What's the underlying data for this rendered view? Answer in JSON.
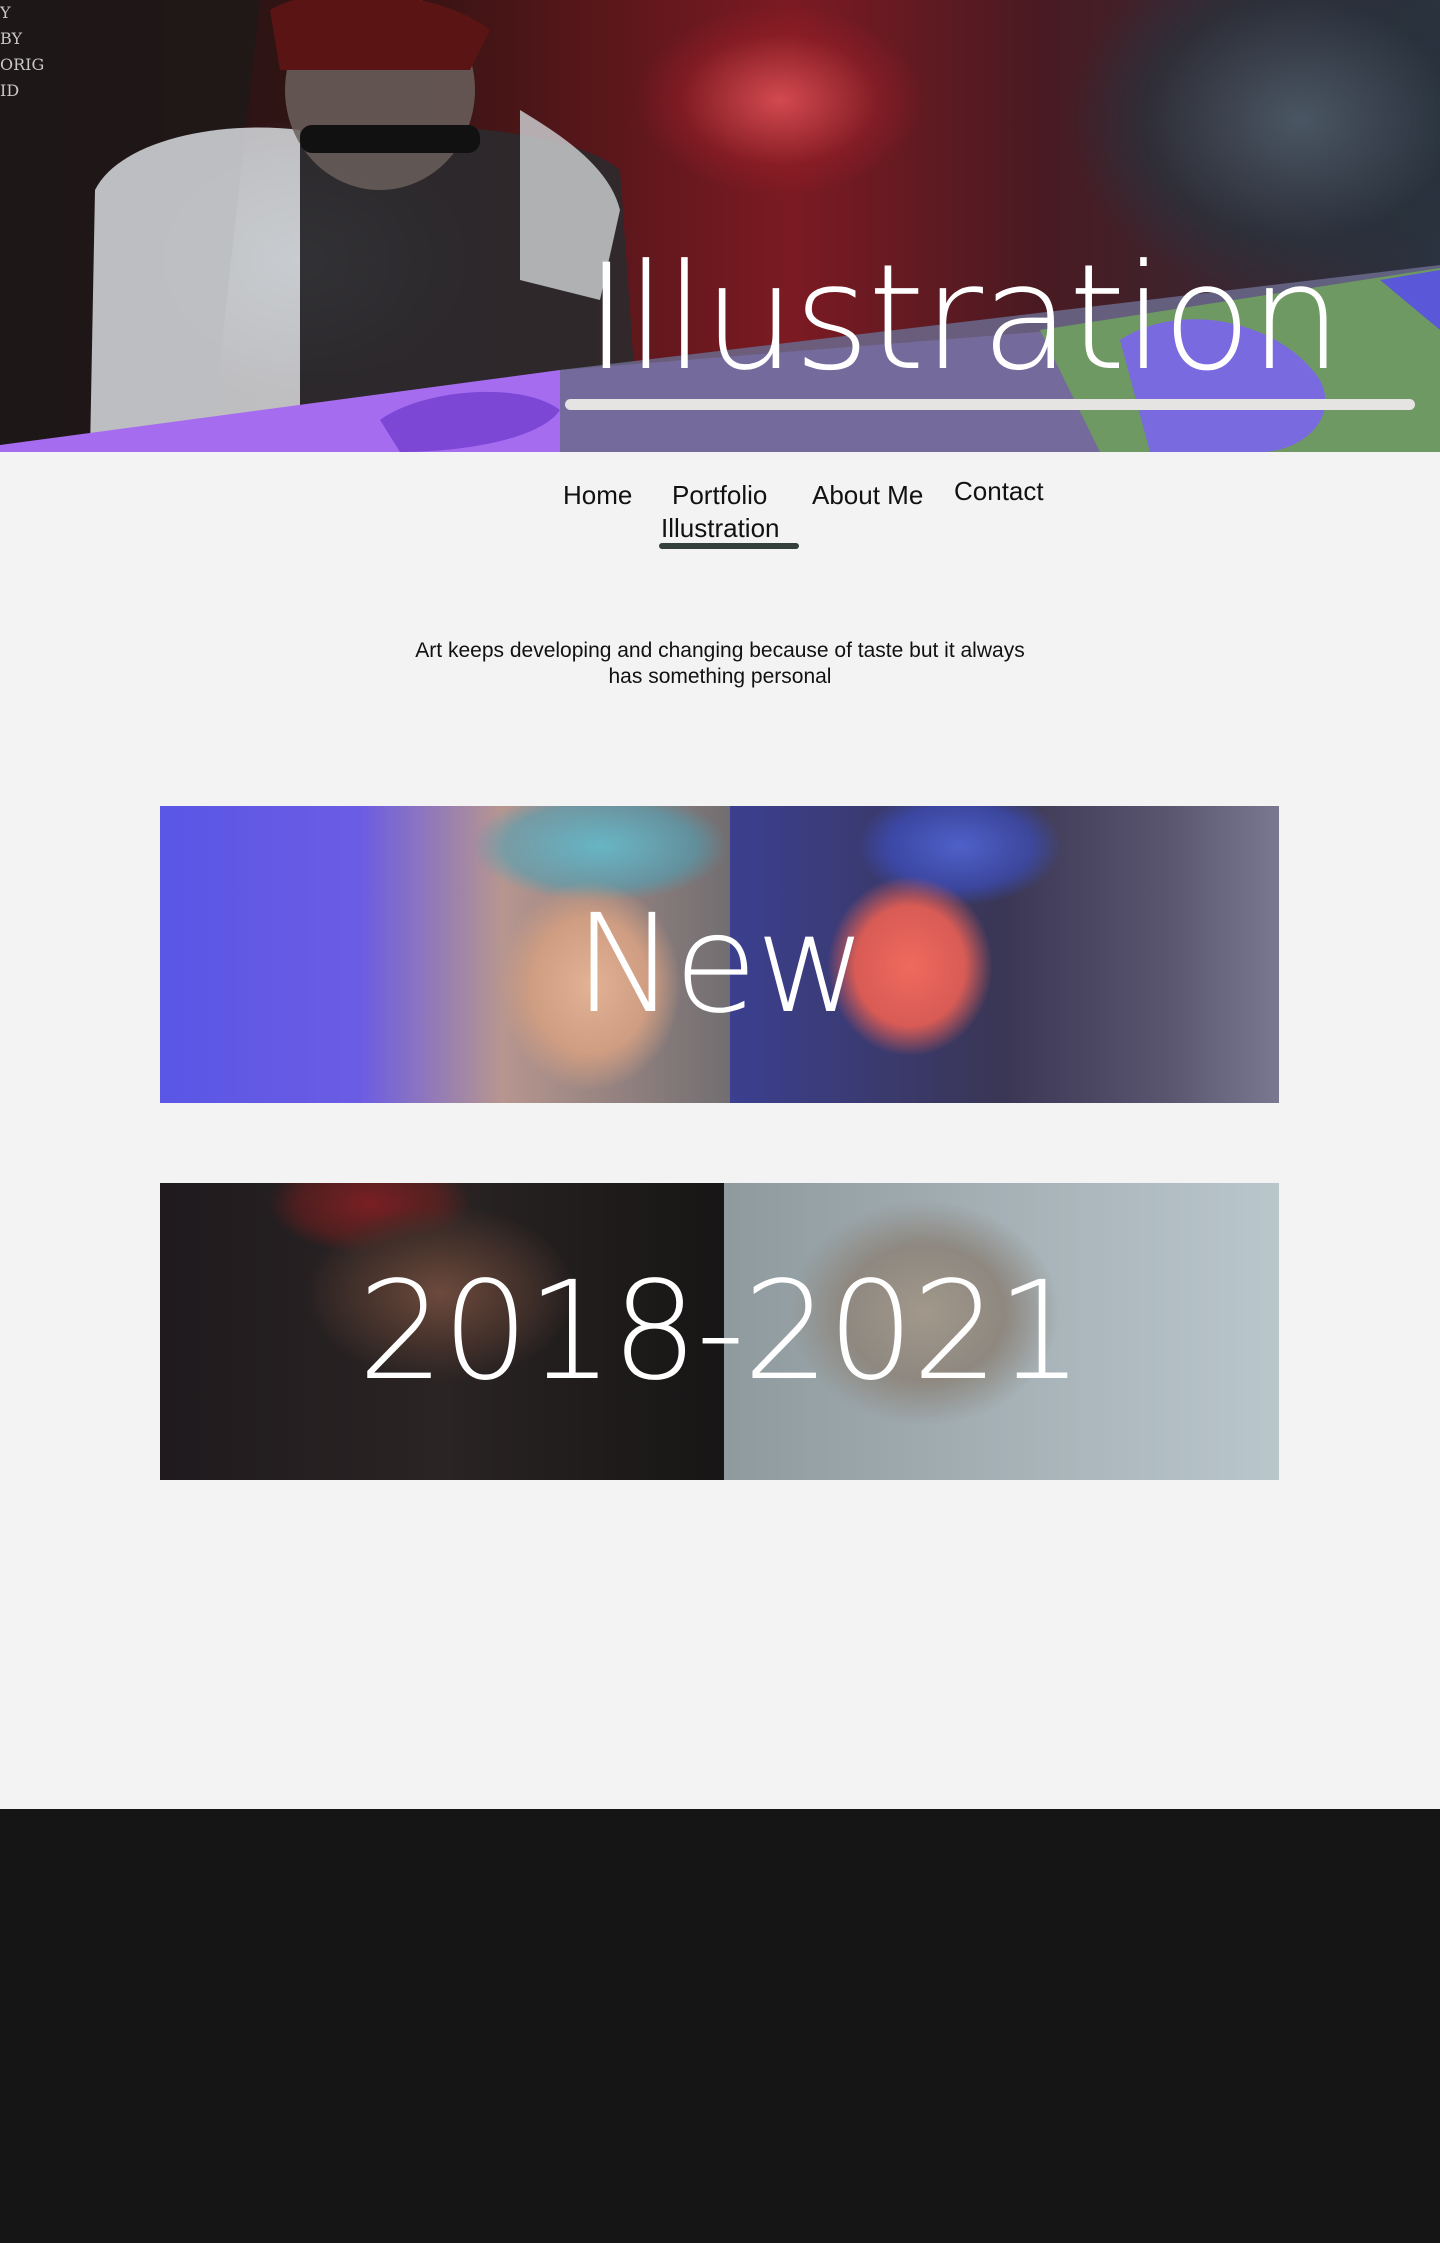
{
  "hero": {
    "title": "Illustration",
    "side_text": "Y\nBY\nORIG\nID"
  },
  "nav": {
    "home": "Home",
    "portfolio": "Portfolio",
    "about": "About Me",
    "contact": "Contact",
    "illustration": "Illustration",
    "active": "Illustration"
  },
  "tagline": "Art keeps developing and changing  because of taste but it always has something personal",
  "gallery": {
    "tiles": [
      {
        "label": "New"
      },
      {
        "label": "2018-2021"
      }
    ]
  },
  "colors": {
    "page_background": "#f3f3f3",
    "nav_active": "#34403b",
    "footer": "#151515",
    "hero_purple": "#a66cf0",
    "hero_green": "#6f9962"
  }
}
